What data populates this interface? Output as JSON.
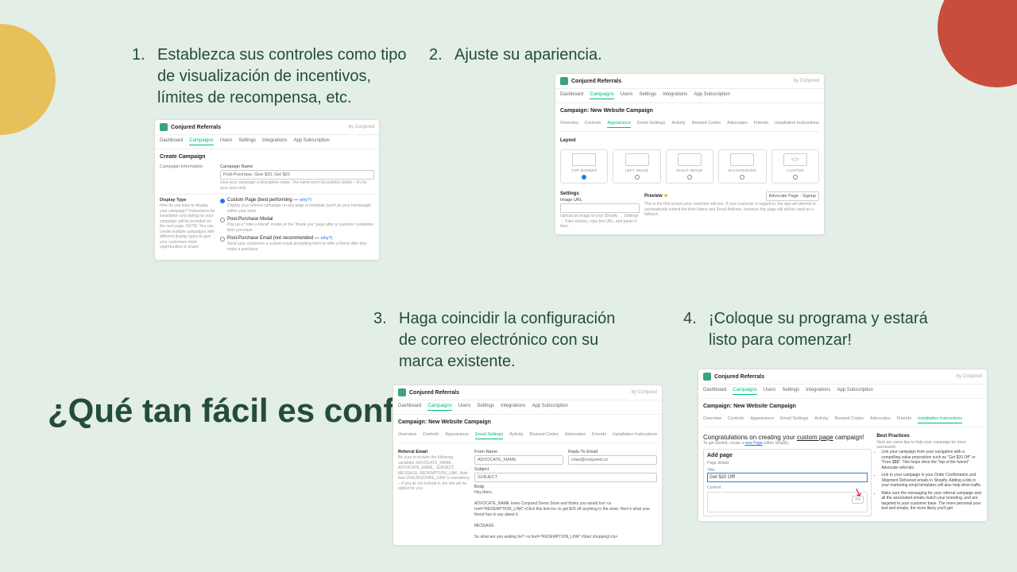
{
  "heading": "¿Qué tan fácil es configurar?",
  "steps": {
    "s1": {
      "num": "1.",
      "text": "Establezca sus controles como tipo de visualización de incentivos, límites de recompensa, etc."
    },
    "s2": {
      "num": "2.",
      "text": "Ajuste su apariencia."
    },
    "s3": {
      "num": "3.",
      "text": "Haga coincidir la configuración de correo electrónico con su marca existente."
    },
    "s4": {
      "num": "4.",
      "text": "¡Coloque su programa y estará listo para comenzar!"
    }
  },
  "shot": {
    "brand": "Conjured Referrals",
    "by": "by Conjured",
    "nav": [
      "Dashboard",
      "Campaigns",
      "Users",
      "Settings",
      "Integrations",
      "App Subscription"
    ],
    "nav_active": "Campaigns",
    "subnav": [
      "Overview",
      "Controls",
      "Appearance",
      "Email Settings",
      "Activity",
      "Reward Codes",
      "Advocates",
      "Friends",
      "Installation Instructions"
    ]
  },
  "s1": {
    "title": "Create Campaign",
    "left_info": "Campaign Information",
    "name_label": "Campaign Name",
    "name_value": "Post-Purchase, Give $20, Get $20",
    "name_hint": "Give your campaign a descriptive name. The name won't be publicly visible – it's for your eyes only.",
    "left_display": "Display Type",
    "left_display_desc": "How do you want to display your campaign? Instructions for installation and styling for your campaign will be provided on the next page. NOTE: You can create multiple campaigns with different display types to give your customers more opportunities to share!",
    "opt1_label": "Custom Page (best performing —",
    "opt1_desc": "Display your referral campaign on any page or template (such as your homepage) within your store.",
    "opt2_label": "Post-Purchase Modal",
    "opt2_desc": "Pop up a \"refer a friend\" modal on the \"thank you\" page after a customer completes their purchase.",
    "opt3_label": "Post-Purchase Email (not recommended —",
    "opt3_desc": "Send your customers a custom email prompting them to refer a friend after they make a purchase.",
    "why": "why?)"
  },
  "s2": {
    "h": "Campaign: New Website Campaign",
    "subnav_sel": "Appearance",
    "layout_label": "Layout",
    "layouts": [
      "TOP BANNER",
      "LEFT IMAGE",
      "RIGHT IMAGE",
      "BACKGROUND",
      "CUSTOM"
    ],
    "settings": "Settings",
    "image_url": "Image URL",
    "image_hint": "Upload an image to your Shopify → Settings → Files section, copy the URL, and paste it here.",
    "preview": "Preview",
    "preview_select": "Advocate Page - Signup",
    "preview_desc": "This is the first screen your customer will see. If your customer is logged in, the app will attempt to automatically submit the their Name and Email Address, however this page will still be used as a fallback."
  },
  "s3": {
    "h": "Campaign: New Website Campaign",
    "subnav_sel": "Email Settings",
    "left_title": "Referral Email",
    "left_desc": "Be sure to include the following variables: ADVOCATE_NAME, ADVOCATE_EMAIL, SUBJECT, MESSAGE, REDEMPTION_LINK. Note that UNSUBSCRIBE_LINK is mandatory – if you do not include it, the link will be added for you.",
    "from_name_label": "From Name",
    "from_name_value": "ADVOCATE_NAME",
    "reply_to_label": "Reply-To Email",
    "reply_to_value": "chan@conjured.co",
    "subject_label": "Subject",
    "subject_value": "SUBJECT",
    "body_label": "Body",
    "body_value": "MESSAGE",
    "body_greet": "Hey there,",
    "body_line1": "ADVOCATE_NAME loves Conjured Demo Store and thinks you would too! <a href=\"REDEMPTION_LINK\">Click this link</a> to get $20 off anything in the store. Here's what your friend has to say about it:",
    "body_line2": "So what are you waiting for? <a href=\"REDEMPTION_LINK\">Start shopping!</a>"
  },
  "s4": {
    "h": "Campaign: New Website Campaign",
    "subnav_sel": "Installation Instructions",
    "congrats_a": "Congratulations on creating your ",
    "congrats_u": "custom page",
    "congrats_b": " campaign!",
    "congrats_sub_a": "To get started, create a ",
    "congrats_sub_link": "new Page",
    "congrats_sub_b": " within Shopify.",
    "add_page": "Add page",
    "page_details": "Page details",
    "title_label": "Title",
    "title_value": "Get $20 Off!",
    "content_label": "Content",
    "best_title": "Best Practices",
    "best_intro": "Here are some tips to help your campaign be more successful:",
    "best_items": [
      "Link your campaign from your navigation with a compelling value proposition such as \"Get $20 Off\" or \"Free $$$\". This helps drive the \"top of the funnel\" Advocate referrals.",
      "Link to your campaign in your Order Confirmation and Shipment Delivered emails in Shopify. Adding a link in your marketing email templates will also help drive traffic.",
      "Make sure the messaging for your referral campaign and all the associated emails match your branding, and are targeted to your customer base. The more personal your text and emails, the more likely you'll get"
    ]
  }
}
